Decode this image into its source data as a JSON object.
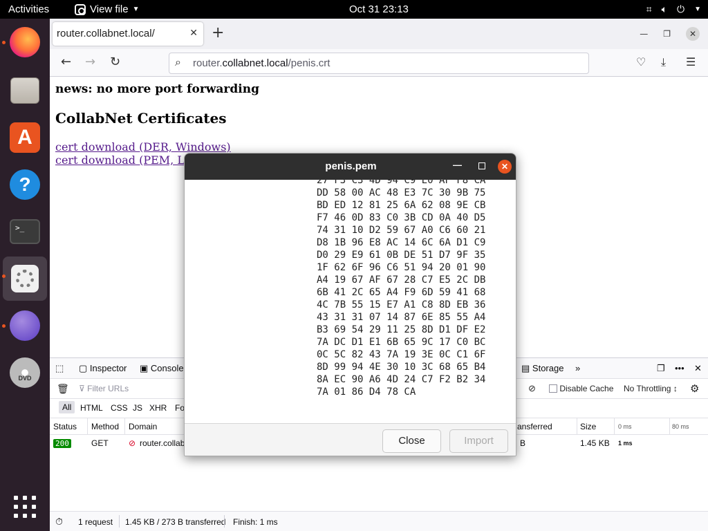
{
  "topbar": {
    "activities": "Activities",
    "app_menu": "View file",
    "clock": "Oct 31  23:13"
  },
  "dock": {
    "items": [
      "firefox",
      "files",
      "software",
      "help",
      "terminal",
      "settings",
      "network",
      "dvd",
      "show-apps"
    ],
    "dvd_label": "DVD",
    "terminal_prompt": ">_",
    "software_glyph": "A",
    "help_glyph": "?"
  },
  "browser": {
    "tab_title": "router.collabnet.local/",
    "url": {
      "prefix": "router.",
      "host": "collabnet.local",
      "path": "/penis.crt"
    }
  },
  "page": {
    "news": "news: no more port forwarding",
    "heading": "CollabNet Certificates",
    "link_der": "cert download (DER, Windows)",
    "link_pem": "cert download (PEM, L"
  },
  "devtools": {
    "tabs": {
      "inspector": "Inspector",
      "console": "Console",
      "storage": "Storage"
    },
    "filter_placeholder": "Filter URLs",
    "disable_cache": "Disable Cache",
    "throttling": "No Throttling ↕",
    "types": [
      "All",
      "HTML",
      "CSS",
      "JS",
      "XHR",
      "Fo"
    ],
    "columns": {
      "status": "Status",
      "method": "Method",
      "domain": "Domain",
      "transferred": "ansferred",
      "size": "Size",
      "t0": "0 ms",
      "t80": "80 ms"
    },
    "row": {
      "status": "200",
      "method": "GET",
      "domain": "router.collab",
      "transferred": "B",
      "size": "1.45 KB",
      "time": "1 ms"
    },
    "footer": {
      "requests": "1 request",
      "transfer": "1.45 KB / 273 B transferred",
      "finish": "Finish: 1 ms"
    }
  },
  "dialog": {
    "title": "penis.pem",
    "hex_lines": [
      "27 F3 C3 4D 94 C9 E0 AF F8 CA",
      "DD 58 00 AC 48 E3 7C 30 9B 75",
      "BD ED 12 81 25 6A 62 08 9E CB",
      "F7 46 0D 83 C0 3B CD 0A 40 D5",
      "74 31 10 D2 59 67 A0 C6 60 21",
      "D8 1B 96 E8 AC 14 6C 6A D1 C9",
      "D0 29 E9 61 0B DE 51 D7 9F 35",
      "1F 62 6F 96 C6 51 94 20 01 90",
      "A4 19 67 AF 67 28 C7 E5 2C DB",
      "6B 41 2C 65 A4 F9 6D 59 41 68",
      "4C 7B 55 15 E7 A1 C8 8D EB 36",
      "43 31 31 07 14 87 6E 85 55 A4",
      "B3 69 54 29 11 25 8D D1 DF E2",
      "7A DC D1 E1 6B 65 9C 17 C0 BC",
      "0C 5C 82 43 7A 19 3E 0C C1 6F",
      "8D 99 94 4E 30 10 3C 68 65 B4",
      "8A EC 90 A6 4D 24 C7 F2 B2 34",
      "7A 01 86 D4 78 CA"
    ],
    "close_label": "Close",
    "import_label": "Import"
  }
}
